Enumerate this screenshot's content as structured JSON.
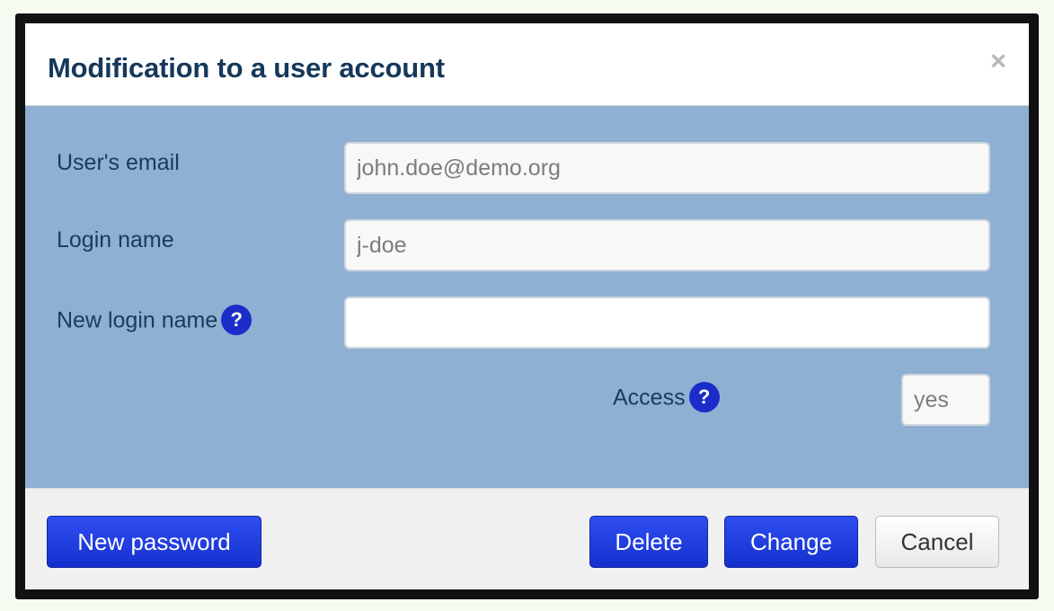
{
  "dialog": {
    "title": "Modification to a user account",
    "close_glyph": "×"
  },
  "form": {
    "email": {
      "label": "User's email",
      "value": "john.doe@demo.org"
    },
    "login": {
      "label": "Login name",
      "value": "j-doe"
    },
    "new_login": {
      "label": "New login name",
      "value": "",
      "help_glyph": "?"
    },
    "access": {
      "label": "Access",
      "value": "yes",
      "help_glyph": "?"
    }
  },
  "footer": {
    "new_password_label": "New password",
    "delete_label": "Delete",
    "change_label": "Change",
    "cancel_label": "Cancel"
  },
  "colors": {
    "title": "#15385a",
    "body_background": "#8fb0d3",
    "primary_button": "#1f3fe0",
    "help_icon": "#1b2dc9",
    "footer_background": "#f0f0f0"
  },
  "icons": {
    "close": "close-icon",
    "help": "question-mark-icon"
  }
}
